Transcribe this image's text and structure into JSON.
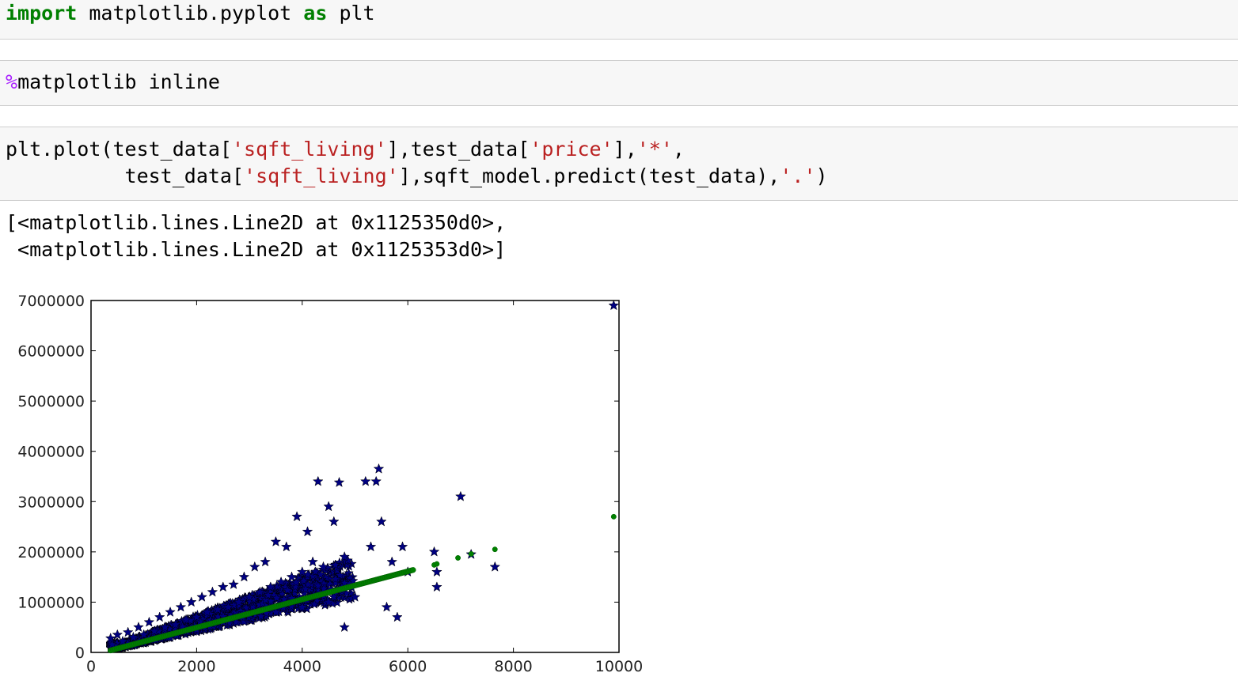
{
  "cells": {
    "cell1": {
      "kw_import": "import",
      "module": " matplotlib.pyplot ",
      "kw_as": "as",
      "alias": " plt"
    },
    "cell2": {
      "percent": "%",
      "magic": "matplotlib inline"
    },
    "cell3": {
      "l1_a": "plt.plot(test_data[",
      "l1_s1": "'sqft_living'",
      "l1_b": "],test_data[",
      "l1_s2": "'price'",
      "l1_c": "],",
      "l1_s3": "'*'",
      "l1_d": ",",
      "l2_a": "          test_data[",
      "l2_s1": "'sqft_living'",
      "l2_b": "],sqft_model.predict(test_data),",
      "l2_s2": "'.'",
      "l2_c": ")"
    }
  },
  "output": {
    "line1": "[<matplotlib.lines.Line2D at 0x1125350d0>,",
    "line2": " <matplotlib.lines.Line2D at 0x1125353d0>]"
  },
  "chart_data": {
    "type": "scatter",
    "title": "",
    "xlabel": "",
    "ylabel": "",
    "xlim": [
      0,
      10000
    ],
    "ylim": [
      0,
      7000000
    ],
    "x_ticks": [
      0,
      2000,
      4000,
      6000,
      8000,
      10000
    ],
    "y_ticks": [
      0,
      1000000,
      2000000,
      3000000,
      4000000,
      5000000,
      6000000,
      7000000
    ],
    "x_tick_labels": [
      "0",
      "2000",
      "4000",
      "6000",
      "8000",
      "10000"
    ],
    "y_tick_labels": [
      "0",
      "1000000",
      "2000000",
      "3000000",
      "4000000",
      "5000000",
      "6000000",
      "7000000"
    ],
    "grid": false,
    "series": [
      {
        "marker": "star",
        "color": "#000080",
        "points": [
          [
            370,
            280000
          ],
          [
            500,
            350000
          ],
          [
            600,
            220000
          ],
          [
            700,
            400000
          ],
          [
            800,
            300000
          ],
          [
            900,
            500000
          ],
          [
            1000,
            350000
          ],
          [
            1100,
            600000
          ],
          [
            1200,
            420000
          ],
          [
            1300,
            700000
          ],
          [
            1400,
            500000
          ],
          [
            1500,
            800000
          ],
          [
            1600,
            550000
          ],
          [
            1700,
            900000
          ],
          [
            1800,
            650000
          ],
          [
            1900,
            1000000
          ],
          [
            2000,
            700000
          ],
          [
            2100,
            1100000
          ],
          [
            2200,
            800000
          ],
          [
            2300,
            1200000
          ],
          [
            2400,
            850000
          ],
          [
            2500,
            1300000
          ],
          [
            2600,
            900000
          ],
          [
            2700,
            1350000
          ],
          [
            2800,
            1000000
          ],
          [
            2900,
            1500000
          ],
          [
            3000,
            1100000
          ],
          [
            3100,
            1700000
          ],
          [
            3200,
            1200000
          ],
          [
            3300,
            1800000
          ],
          [
            3400,
            1300000
          ],
          [
            3500,
            2200000
          ],
          [
            3600,
            1400000
          ],
          [
            3700,
            2100000
          ],
          [
            3800,
            1500000
          ],
          [
            3900,
            2700000
          ],
          [
            4000,
            1600000
          ],
          [
            4100,
            2400000
          ],
          [
            4200,
            1800000
          ],
          [
            4300,
            3400000
          ],
          [
            4400,
            1700000
          ],
          [
            4500,
            2900000
          ],
          [
            4600,
            2600000
          ],
          [
            4700,
            3380000
          ],
          [
            4800,
            1900000
          ],
          [
            5200,
            3400000
          ],
          [
            5300,
            2100000
          ],
          [
            5400,
            3400000
          ],
          [
            5450,
            3650000
          ],
          [
            5500,
            2600000
          ],
          [
            5600,
            900000
          ],
          [
            5700,
            1800000
          ],
          [
            5800,
            700000
          ],
          [
            5900,
            2100000
          ],
          [
            6000,
            1600000
          ],
          [
            6500,
            2000000
          ],
          [
            6550,
            1300000
          ],
          [
            6550,
            1600000
          ],
          [
            7000,
            3100000
          ],
          [
            7200,
            1950000
          ],
          [
            7650,
            1700000
          ],
          [
            9900,
            6900000
          ],
          [
            1000,
            200000
          ],
          [
            1500,
            300000
          ],
          [
            2000,
            450000
          ],
          [
            2500,
            600000
          ],
          [
            3000,
            750000
          ],
          [
            3500,
            800000
          ],
          [
            4000,
            900000
          ],
          [
            4500,
            1000000
          ],
          [
            4800,
            500000
          ],
          [
            5000,
            1100000
          ]
        ]
      },
      {
        "marker": "point",
        "color": "#008000",
        "line_fit": {
          "x_start": 370,
          "x_end": 6100,
          "y_start": 40000,
          "y_end": 1640000
        },
        "extra_points": [
          [
            6500,
            1740000
          ],
          [
            6550,
            1760000
          ],
          [
            6950,
            1880000
          ],
          [
            7200,
            1960000
          ],
          [
            7650,
            2050000
          ],
          [
            9900,
            2700000
          ]
        ]
      }
    ]
  }
}
